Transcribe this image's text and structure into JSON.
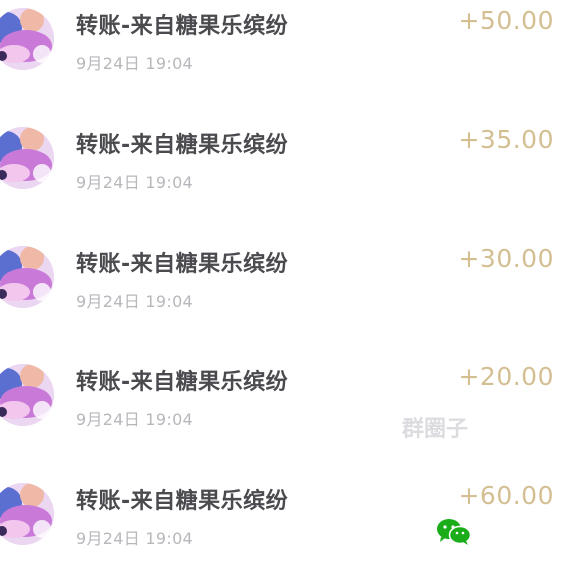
{
  "transactions": [
    {
      "title": "转账-来自糖果乐缤纷",
      "time": "9月24日 19:04",
      "amount": "+50.00"
    },
    {
      "title": "转账-来自糖果乐缤纷",
      "time": "9月24日 19:04",
      "amount": "+35.00"
    },
    {
      "title": "转账-来自糖果乐缤纷",
      "time": "9月24日 19:04",
      "amount": "+30.00"
    },
    {
      "title": "转账-来自糖果乐缤纷",
      "time": "9月24日 19:04",
      "amount": "+20.00"
    },
    {
      "title": "转账-来自糖果乐缤纷",
      "time": "9月24日 19:04",
      "amount": "+60.00"
    }
  ],
  "watermark": {
    "text": "群圈子",
    "logo_icon": "wechat-icon"
  },
  "colors": {
    "amount": "#d4bf93",
    "title": "#4a4a4f",
    "time": "#b7b7bc",
    "wechat_green": "#1aad19"
  }
}
